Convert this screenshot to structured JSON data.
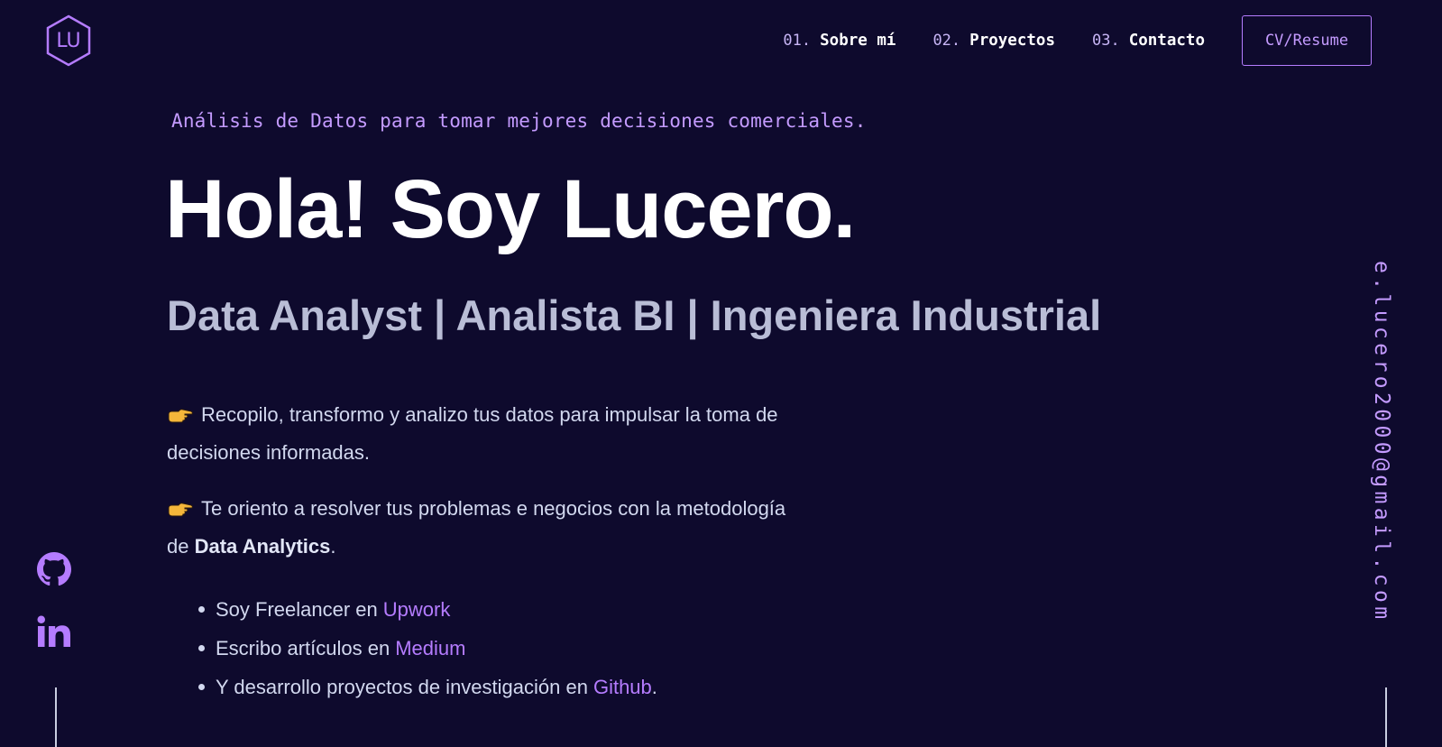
{
  "logo": {
    "text": "LU"
  },
  "nav": {
    "items": [
      {
        "num": "01.",
        "label": "Sobre mí"
      },
      {
        "num": "02.",
        "label": "Proyectos"
      },
      {
        "num": "03.",
        "label": "Contacto"
      }
    ],
    "cv_label": "CV/Resume"
  },
  "hero": {
    "tagline": "Análisis de Datos para tomar mejores decisiones comerciales.",
    "title": "Hola! Soy Lucero.",
    "subtitle": "Data Analyst | Analista BI | Ingeniera Industrial",
    "para1": "Recopilo, transformo y analizo tus datos para impulsar la toma de decisiones informadas.",
    "para2_before": "Te oriento a resolver tus problemas e negocios con la metodología de ",
    "para2_bold": "Data Analytics",
    "para2_after": ".",
    "bullets": [
      {
        "text": "Soy Freelancer en",
        "link": "Upwork",
        "suffix": ""
      },
      {
        "text": "Escribo artículos en",
        "link": "Medium",
        "suffix": ""
      },
      {
        "text": "Y desarrollo proyectos de investigación en",
        "link": "Github",
        "suffix": "."
      }
    ]
  },
  "social": {
    "github_icon": "github-icon",
    "linkedin_icon": "linkedin-icon"
  },
  "email": "e.lucero2000@gmail.com",
  "colors": {
    "background": "#0e0a2d",
    "accent": "#b57cff",
    "text": "#ccd6f6"
  }
}
